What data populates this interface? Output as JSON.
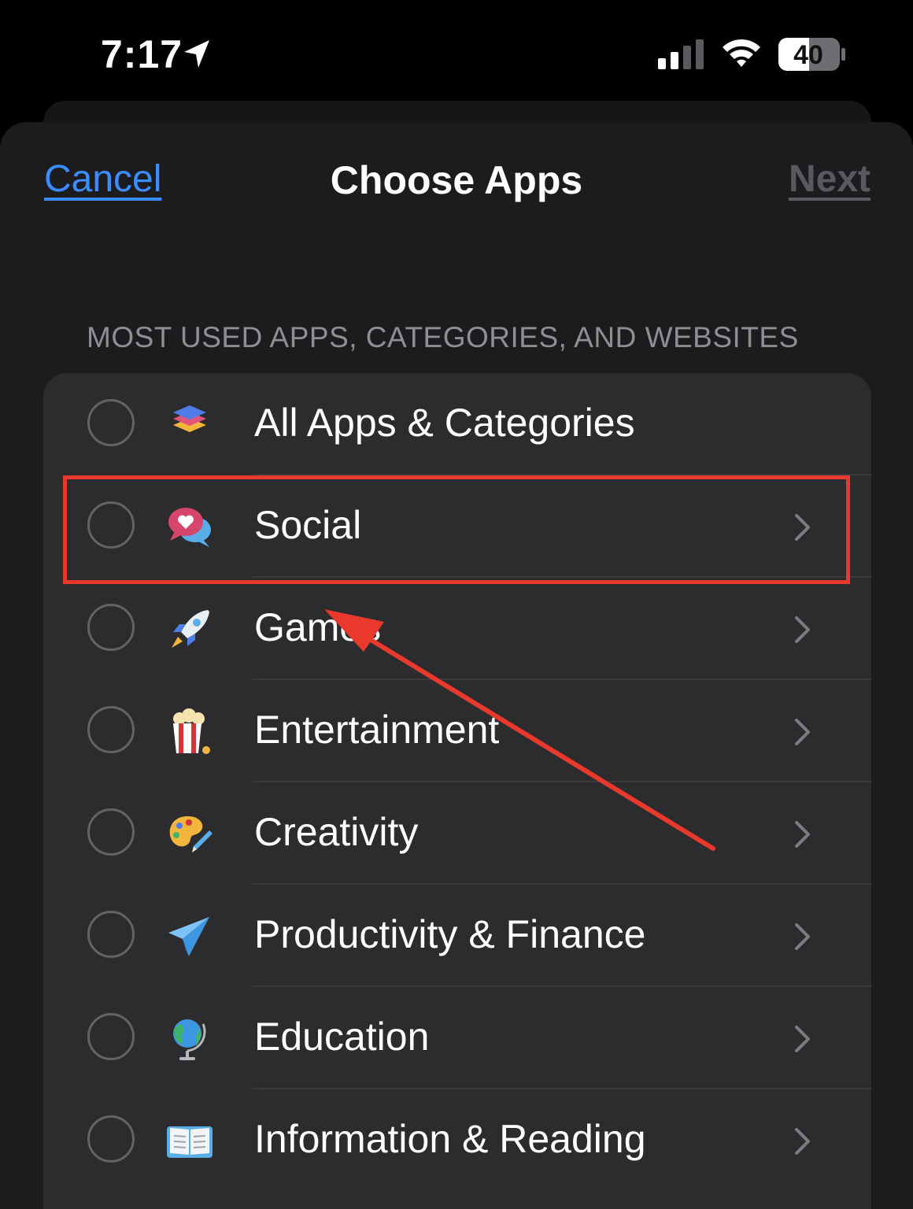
{
  "status_bar": {
    "time": "7:17",
    "battery": "40",
    "icons": [
      "location-arrow-icon",
      "cellular-signal-icon",
      "wifi-icon",
      "battery-icon"
    ]
  },
  "nav": {
    "cancel_label": "Cancel",
    "title": "Choose Apps",
    "next_label": "Next"
  },
  "section_header": "MOST USED APPS, CATEGORIES, AND WEBSITES",
  "categories": [
    {
      "label": "All Apps & Categories",
      "icon": "stack-icon",
      "has_chevron": false
    },
    {
      "label": "Social",
      "icon": "speech-bubbles-icon",
      "has_chevron": true
    },
    {
      "label": "Games",
      "icon": "rocket-icon",
      "has_chevron": true
    },
    {
      "label": "Entertainment",
      "icon": "popcorn-icon",
      "has_chevron": true
    },
    {
      "label": "Creativity",
      "icon": "palette-icon",
      "has_chevron": true
    },
    {
      "label": "Productivity & Finance",
      "icon": "paper-plane-icon",
      "has_chevron": true
    },
    {
      "label": "Education",
      "icon": "globe-icon",
      "has_chevron": true
    },
    {
      "label": "Information & Reading",
      "icon": "book-icon",
      "has_chevron": true
    }
  ],
  "colors": {
    "accent": "#3b8cff",
    "disabled": "#5a5a5e",
    "annotation": "#e8392c",
    "list_bg": "#2c2c2e",
    "sheet_bg": "#1c1c1e"
  }
}
